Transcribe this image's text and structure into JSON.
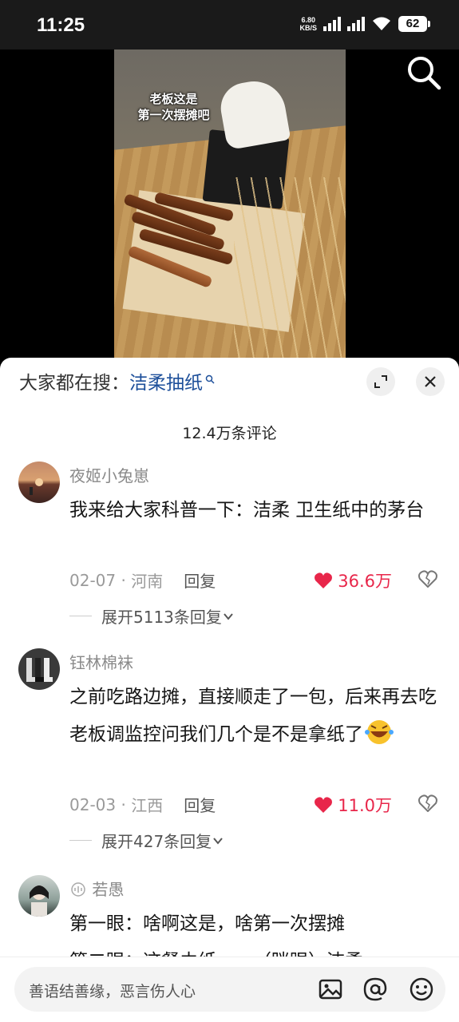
{
  "status_bar": {
    "time": "11:25",
    "net_speed_value": "6.80",
    "net_speed_unit": "KB/S",
    "battery": "62"
  },
  "video": {
    "caption_line1": "老板这是",
    "caption_line2": "第一次摆摊吧"
  },
  "sheet": {
    "search_prefix": "大家都在搜：",
    "search_keyword": "洁柔抽纸",
    "comment_count": "12.4万条评论"
  },
  "comments": [
    {
      "username": "夜姬小兔崽",
      "text": "我来给大家科普一下：洁柔 卫生纸中的茅台",
      "date": "02-07",
      "location": "河南",
      "reply_label": "回复",
      "likes": "36.6万",
      "expand_label": "展开5113条回复"
    },
    {
      "username": "钰林棉袜",
      "text": "之前吃路边摊，直接顺走了一包，后来再去吃老板调监控问我们几个是不是拿纸了",
      "date": "02-03",
      "location": "江西",
      "reply_label": "回复",
      "likes": "11.0万",
      "expand_label": "展开427条回复"
    },
    {
      "username": "若愚",
      "text_line1": "第一眼：啥啊这是，啥第一次摆摊",
      "text_line2": "第二眼：这餐巾纸……（眯眼）洁柔"
    }
  ],
  "input_bar": {
    "placeholder": "善语结善缘，恶言伤人心"
  },
  "colors": {
    "like_red": "#e8264a",
    "keyword_blue": "#1d4f9a"
  }
}
